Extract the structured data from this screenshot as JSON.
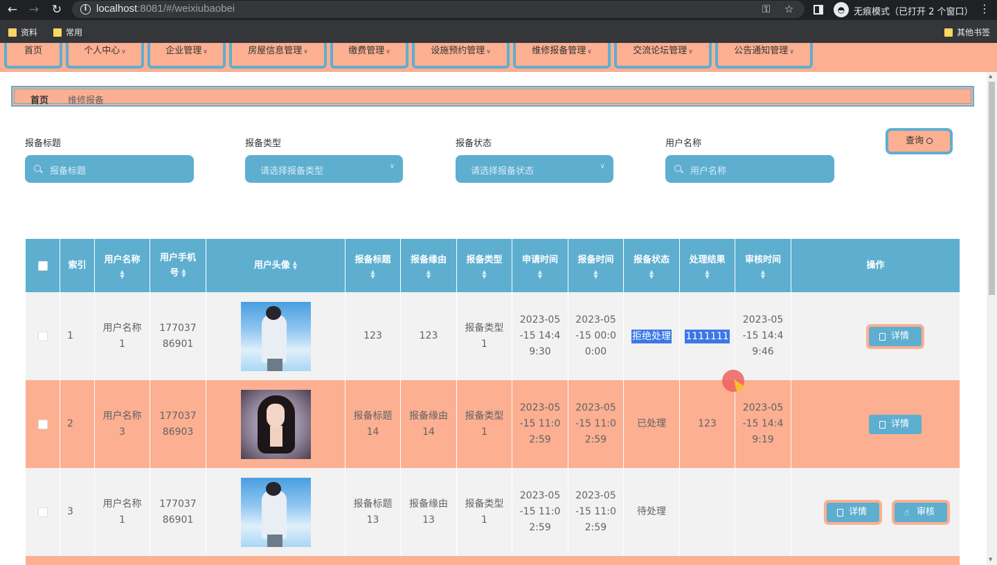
{
  "browser": {
    "url_host": "localhost",
    "url_rest": ":8081/#/weixiubaobei",
    "incognito_label": "无痕模式（已打开 2 个窗口）",
    "bookmarks": [
      "资料",
      "常用"
    ],
    "other_bookmarks": "其他书签"
  },
  "nav": {
    "items": [
      {
        "label": "首页",
        "has_dropdown": false
      },
      {
        "label": "个人中心",
        "has_dropdown": true
      },
      {
        "label": "企业管理",
        "has_dropdown": true
      },
      {
        "label": "房屋信息管理",
        "has_dropdown": true
      },
      {
        "label": "缴费管理",
        "has_dropdown": true
      },
      {
        "label": "设施预约管理",
        "has_dropdown": true
      },
      {
        "label": "维修报备管理",
        "has_dropdown": true
      },
      {
        "label": "交流论坛管理",
        "has_dropdown": true
      },
      {
        "label": "公告通知管理",
        "has_dropdown": true
      }
    ]
  },
  "breadcrumb": {
    "home": "首页",
    "separator": "/",
    "current": "维修报备"
  },
  "search": {
    "fields": [
      {
        "label": "报备标题",
        "placeholder": "报备标题",
        "type": "input"
      },
      {
        "label": "报备类型",
        "placeholder": "请选择报备类型",
        "type": "select"
      },
      {
        "label": "报备状态",
        "placeholder": "请选择报备状态",
        "type": "select"
      },
      {
        "label": "用户名称",
        "placeholder": "用户名称",
        "type": "input"
      }
    ],
    "query_button": "查询"
  },
  "table": {
    "headers": [
      "索引",
      "用户名称",
      "用户手机号",
      "用户头像",
      "报备标题",
      "报备缘由",
      "报备类型",
      "申请时间",
      "报备时间",
      "报备状态",
      "处理结果",
      "审核时间",
      "操作"
    ],
    "rows": [
      {
        "index": "1",
        "user_name": "用户名称1",
        "phone": "17703786901",
        "avatar": "boy-avatar",
        "title": "123",
        "reason": "123",
        "type": "报备类型1",
        "apply_time": "2023-05-15 14:49:30",
        "report_time": "2023-05-15 00:00:00",
        "status": "拒绝处理",
        "result": "1111111",
        "review_time": "2023-05-15 14:49:46",
        "actions": [
          "详情"
        ]
      },
      {
        "index": "2",
        "user_name": "用户名称3",
        "phone": "17703786903",
        "avatar": "girl-avatar",
        "title": "报备标题14",
        "reason": "报备缘由14",
        "type": "报备类型1",
        "apply_time": "2023-05-15 11:02:59",
        "report_time": "2023-05-15 11:02:59",
        "status": "已处理",
        "result": "123",
        "review_time": "2023-05-15 14:49:19",
        "actions": [
          "详情"
        ]
      },
      {
        "index": "3",
        "user_name": "用户名称1",
        "phone": "17703786901",
        "avatar": "boy-avatar",
        "title": "报备标题13",
        "reason": "报备缘由13",
        "type": "报备类型1",
        "apply_time": "2023-05-15 11:02:59",
        "report_time": "2023-05-15 11:02:59",
        "status": "待处理",
        "result": "",
        "review_time": "",
        "actions": [
          "详情",
          "审核"
        ]
      }
    ]
  },
  "colors": {
    "primary_blue": "#5eaed0",
    "accent_salmon": "#fcaf91",
    "selection": "#3b78e7"
  }
}
